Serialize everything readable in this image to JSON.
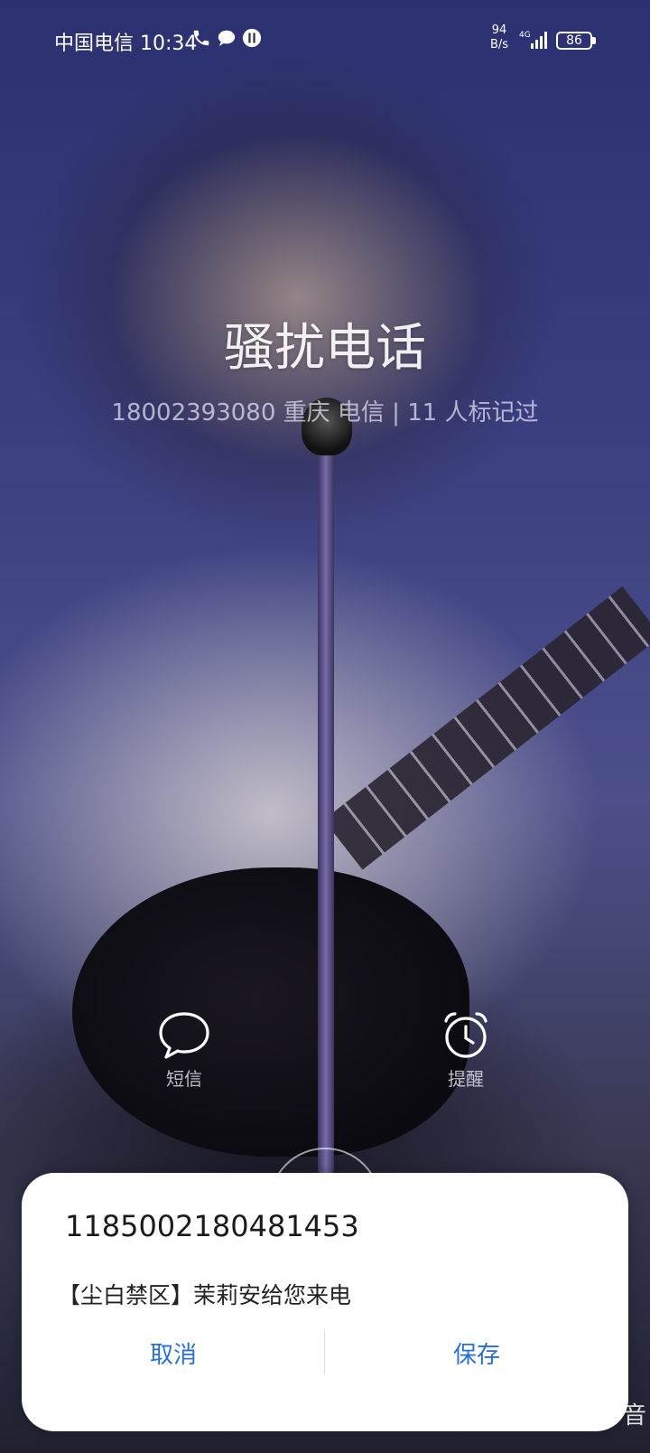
{
  "status_bar": {
    "carrier_time": "中国电信 10:34",
    "net_speed_value": "94",
    "net_speed_unit": "B/s",
    "network_type": "4G",
    "battery": "86",
    "icons": [
      "phone-icon",
      "message-icon",
      "app-notification-icon",
      "signal-icon",
      "battery-icon"
    ]
  },
  "call": {
    "title": "骚扰电话",
    "subtitle": "18002393080  重庆 电信 | 11 人标记过"
  },
  "actions": {
    "sms_label": "短信",
    "remind_label": "提醒"
  },
  "dialog": {
    "number": "1185002180481453",
    "message": "【尘白禁区】茉莉安给您来电",
    "cancel_label": "取消",
    "save_label": "保存",
    "accent_color": "#2a6fd6"
  },
  "corner_text": "音"
}
